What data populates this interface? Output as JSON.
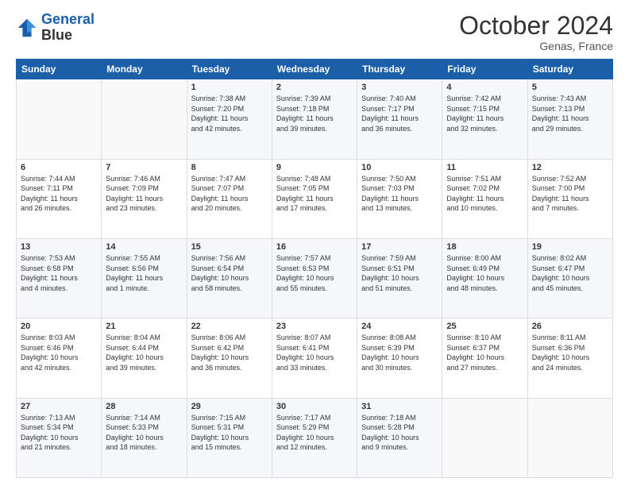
{
  "logo": {
    "line1": "General",
    "line2": "Blue"
  },
  "header": {
    "month": "October 2024",
    "location": "Genas, France"
  },
  "weekdays": [
    "Sunday",
    "Monday",
    "Tuesday",
    "Wednesday",
    "Thursday",
    "Friday",
    "Saturday"
  ],
  "weeks": [
    [
      {
        "day": "",
        "info": ""
      },
      {
        "day": "",
        "info": ""
      },
      {
        "day": "1",
        "info": "Sunrise: 7:38 AM\nSunset: 7:20 PM\nDaylight: 11 hours\nand 42 minutes."
      },
      {
        "day": "2",
        "info": "Sunrise: 7:39 AM\nSunset: 7:18 PM\nDaylight: 11 hours\nand 39 minutes."
      },
      {
        "day": "3",
        "info": "Sunrise: 7:40 AM\nSunset: 7:17 PM\nDaylight: 11 hours\nand 36 minutes."
      },
      {
        "day": "4",
        "info": "Sunrise: 7:42 AM\nSunset: 7:15 PM\nDaylight: 11 hours\nand 32 minutes."
      },
      {
        "day": "5",
        "info": "Sunrise: 7:43 AM\nSunset: 7:13 PM\nDaylight: 11 hours\nand 29 minutes."
      }
    ],
    [
      {
        "day": "6",
        "info": "Sunrise: 7:44 AM\nSunset: 7:11 PM\nDaylight: 11 hours\nand 26 minutes."
      },
      {
        "day": "7",
        "info": "Sunrise: 7:46 AM\nSunset: 7:09 PM\nDaylight: 11 hours\nand 23 minutes."
      },
      {
        "day": "8",
        "info": "Sunrise: 7:47 AM\nSunset: 7:07 PM\nDaylight: 11 hours\nand 20 minutes."
      },
      {
        "day": "9",
        "info": "Sunrise: 7:48 AM\nSunset: 7:05 PM\nDaylight: 11 hours\nand 17 minutes."
      },
      {
        "day": "10",
        "info": "Sunrise: 7:50 AM\nSunset: 7:03 PM\nDaylight: 11 hours\nand 13 minutes."
      },
      {
        "day": "11",
        "info": "Sunrise: 7:51 AM\nSunset: 7:02 PM\nDaylight: 11 hours\nand 10 minutes."
      },
      {
        "day": "12",
        "info": "Sunrise: 7:52 AM\nSunset: 7:00 PM\nDaylight: 11 hours\nand 7 minutes."
      }
    ],
    [
      {
        "day": "13",
        "info": "Sunrise: 7:53 AM\nSunset: 6:58 PM\nDaylight: 11 hours\nand 4 minutes."
      },
      {
        "day": "14",
        "info": "Sunrise: 7:55 AM\nSunset: 6:56 PM\nDaylight: 11 hours\nand 1 minute."
      },
      {
        "day": "15",
        "info": "Sunrise: 7:56 AM\nSunset: 6:54 PM\nDaylight: 10 hours\nand 58 minutes."
      },
      {
        "day": "16",
        "info": "Sunrise: 7:57 AM\nSunset: 6:53 PM\nDaylight: 10 hours\nand 55 minutes."
      },
      {
        "day": "17",
        "info": "Sunrise: 7:59 AM\nSunset: 6:51 PM\nDaylight: 10 hours\nand 51 minutes."
      },
      {
        "day": "18",
        "info": "Sunrise: 8:00 AM\nSunset: 6:49 PM\nDaylight: 10 hours\nand 48 minutes."
      },
      {
        "day": "19",
        "info": "Sunrise: 8:02 AM\nSunset: 6:47 PM\nDaylight: 10 hours\nand 45 minutes."
      }
    ],
    [
      {
        "day": "20",
        "info": "Sunrise: 8:03 AM\nSunset: 6:46 PM\nDaylight: 10 hours\nand 42 minutes."
      },
      {
        "day": "21",
        "info": "Sunrise: 8:04 AM\nSunset: 6:44 PM\nDaylight: 10 hours\nand 39 minutes."
      },
      {
        "day": "22",
        "info": "Sunrise: 8:06 AM\nSunset: 6:42 PM\nDaylight: 10 hours\nand 36 minutes."
      },
      {
        "day": "23",
        "info": "Sunrise: 8:07 AM\nSunset: 6:41 PM\nDaylight: 10 hours\nand 33 minutes."
      },
      {
        "day": "24",
        "info": "Sunrise: 8:08 AM\nSunset: 6:39 PM\nDaylight: 10 hours\nand 30 minutes."
      },
      {
        "day": "25",
        "info": "Sunrise: 8:10 AM\nSunset: 6:37 PM\nDaylight: 10 hours\nand 27 minutes."
      },
      {
        "day": "26",
        "info": "Sunrise: 8:11 AM\nSunset: 6:36 PM\nDaylight: 10 hours\nand 24 minutes."
      }
    ],
    [
      {
        "day": "27",
        "info": "Sunrise: 7:13 AM\nSunset: 5:34 PM\nDaylight: 10 hours\nand 21 minutes."
      },
      {
        "day": "28",
        "info": "Sunrise: 7:14 AM\nSunset: 5:33 PM\nDaylight: 10 hours\nand 18 minutes."
      },
      {
        "day": "29",
        "info": "Sunrise: 7:15 AM\nSunset: 5:31 PM\nDaylight: 10 hours\nand 15 minutes."
      },
      {
        "day": "30",
        "info": "Sunrise: 7:17 AM\nSunset: 5:29 PM\nDaylight: 10 hours\nand 12 minutes."
      },
      {
        "day": "31",
        "info": "Sunrise: 7:18 AM\nSunset: 5:28 PM\nDaylight: 10 hours\nand 9 minutes."
      },
      {
        "day": "",
        "info": ""
      },
      {
        "day": "",
        "info": ""
      }
    ]
  ]
}
